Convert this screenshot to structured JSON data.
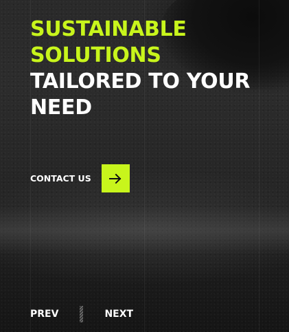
{
  "hero": {
    "headline_accent_line1": "SUSTAINABLE",
    "headline_accent_line2": "SOLUTIONS",
    "headline_white_line1": "TAILORED TO YOUR",
    "headline_white_line2": "NEED"
  },
  "cta": {
    "label": "CONTACT US",
    "icon": "arrow-right-icon"
  },
  "pager": {
    "prev_label": "PREV",
    "next_label": "NEXT"
  },
  "colors": {
    "accent": "#c8f51c",
    "text": "#ffffff",
    "background": "#262626"
  }
}
